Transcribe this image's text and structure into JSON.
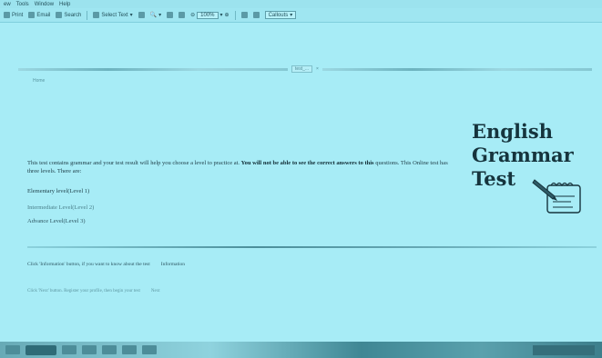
{
  "menu": [
    "ew",
    "Tools",
    "Window",
    "Help"
  ],
  "toolbar": {
    "print": "Print",
    "email": "Email",
    "search": "Search",
    "select_text": "Select Text",
    "zoom": "100%",
    "callouts": "Callouts"
  },
  "tabbar": {
    "tab_label": "test_...",
    "breadcrumb": "Home"
  },
  "page": {
    "intro_prefix": "This test contains grammar and your test result will help you choose a level to practice at.",
    "intro_bold": "You will not be able to see the correct answers to this",
    "intro_suffix": "questions. This Online test has three levels. There are:",
    "levels": [
      "Elementary level(Level 1)",
      "Intermediate Level(Level 2)",
      "Advance Level(Level 3)"
    ],
    "footer_line1_text": "Click 'Information' button, if you want to know about the test",
    "footer_line1_btn": "Information",
    "footer_line2_text": "Click 'Next' button. Register your profile, then begin your test",
    "footer_line2_btn": "Next"
  },
  "logo": {
    "line1": "English",
    "line2": "Grammar",
    "line3": "Test"
  }
}
